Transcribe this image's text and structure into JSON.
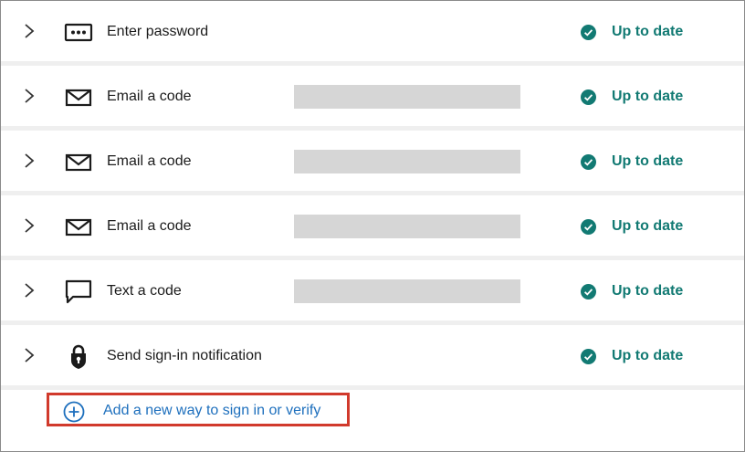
{
  "colors": {
    "status": "#127a73",
    "link": "#1d6fbd",
    "highlight_border": "#d13a2c",
    "redaction": "#d6d6d6"
  },
  "methods": [
    {
      "icon": "password-dots-icon",
      "label": "Enter password",
      "status": "Up to date",
      "redacted": false
    },
    {
      "icon": "envelope-icon",
      "label": "Email a code",
      "status": "Up to date",
      "redacted": true
    },
    {
      "icon": "envelope-icon",
      "label": "Email a code",
      "status": "Up to date",
      "redacted": true
    },
    {
      "icon": "envelope-icon",
      "label": "Email a code",
      "status": "Up to date",
      "redacted": true
    },
    {
      "icon": "chat-bubble-icon",
      "label": "Text a code",
      "status": "Up to date",
      "redacted": true
    },
    {
      "icon": "lock-icon",
      "label": "Send sign-in notification",
      "status": "Up to date",
      "redacted": false
    }
  ],
  "add_method": {
    "icon": "plus-circle-icon",
    "label": "Add a new way to sign in or verify"
  }
}
